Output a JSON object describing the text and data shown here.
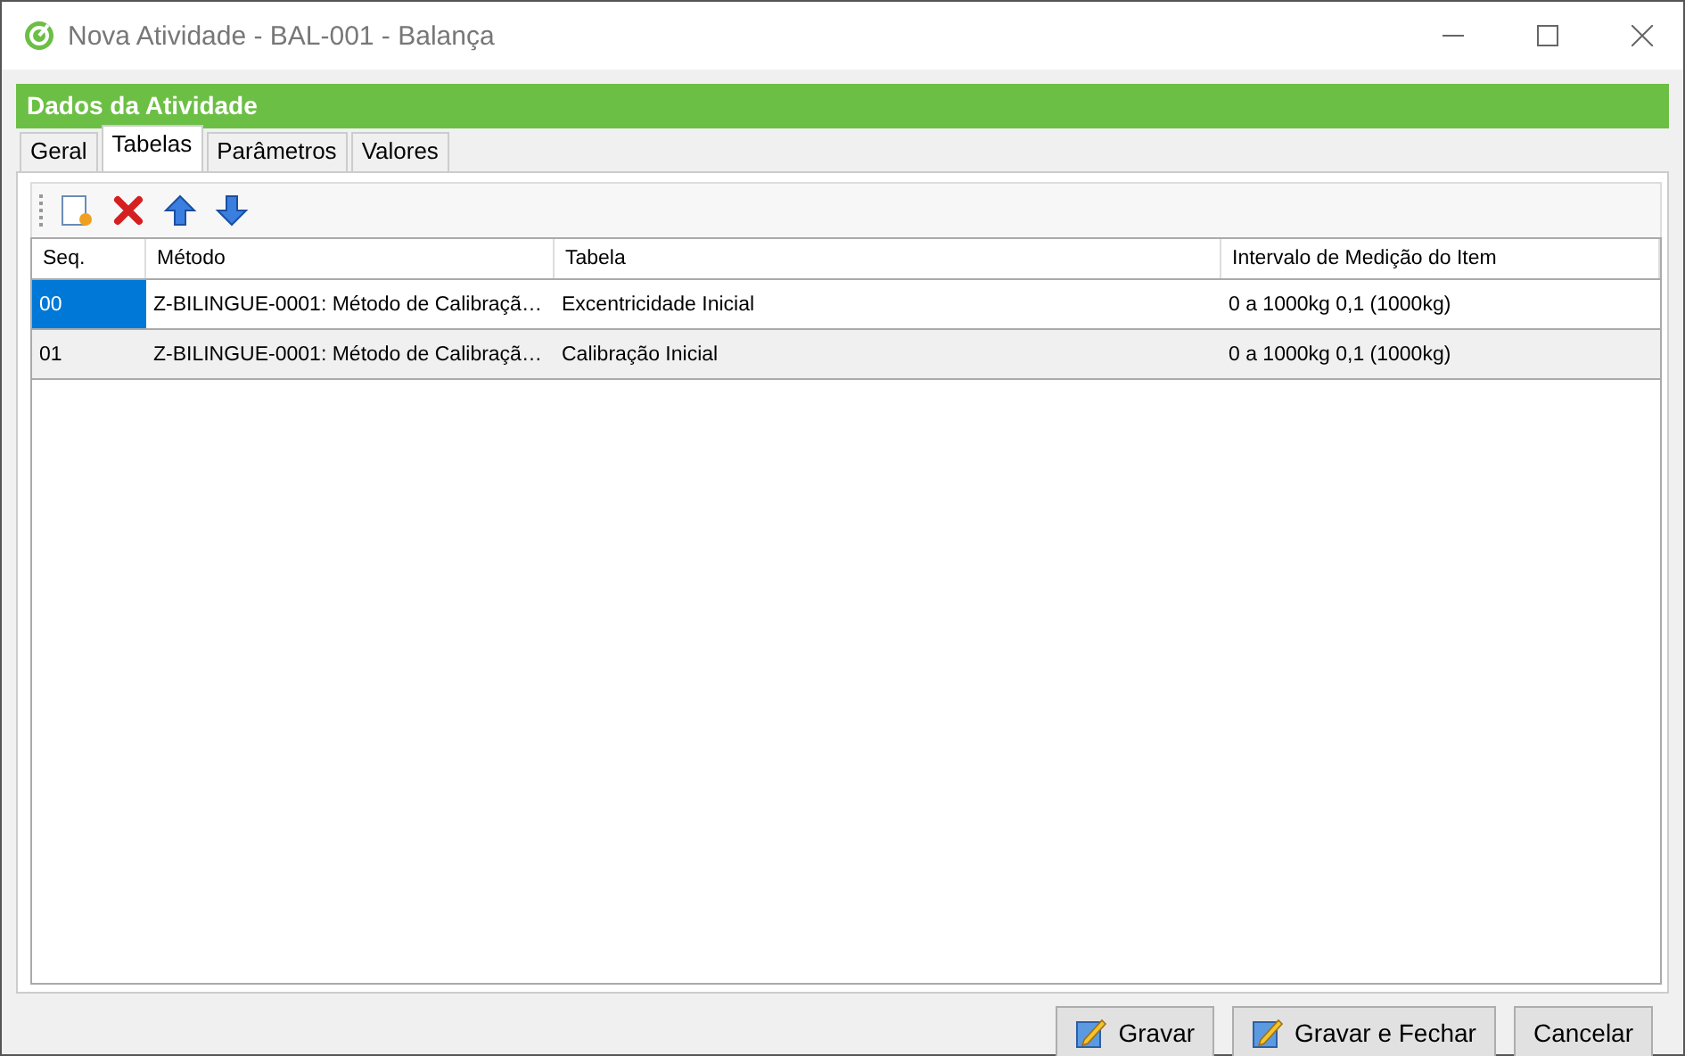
{
  "window": {
    "title": "Nova Atividade - BAL-001 - Balança"
  },
  "header": {
    "title": "Dados da Atividade"
  },
  "tabs": [
    {
      "label": "Geral",
      "selected": false
    },
    {
      "label": "Tabelas",
      "selected": true
    },
    {
      "label": "Parâmetros",
      "selected": false
    },
    {
      "label": "Valores",
      "selected": false
    }
  ],
  "toolbar": [
    {
      "kind": "new"
    },
    {
      "kind": "delete"
    },
    {
      "kind": "up"
    },
    {
      "kind": "down"
    }
  ],
  "table": {
    "columns": [
      "Seq.",
      "Método",
      "Tabela",
      "Intervalo de Medição do Item"
    ],
    "rows": [
      {
        "cells": [
          "00",
          "Z-BILINGUE-0001: Método de Calibraçã…",
          "Excentricidade Inicial",
          "0 a 1000kg 0,1 (1000kg)"
        ],
        "selected": true
      },
      {
        "cells": [
          "01",
          "Z-BILINGUE-0001: Método de Calibraçã…",
          "Calibração Inicial",
          "0 a 1000kg 0,1 (1000kg)"
        ],
        "selected": false
      }
    ]
  },
  "buttons": [
    {
      "label": "Gravar",
      "kind": "save"
    },
    {
      "label": "Gravar e Fechar",
      "kind": "save"
    },
    {
      "label": "Cancelar",
      "kind": "plain"
    }
  ]
}
